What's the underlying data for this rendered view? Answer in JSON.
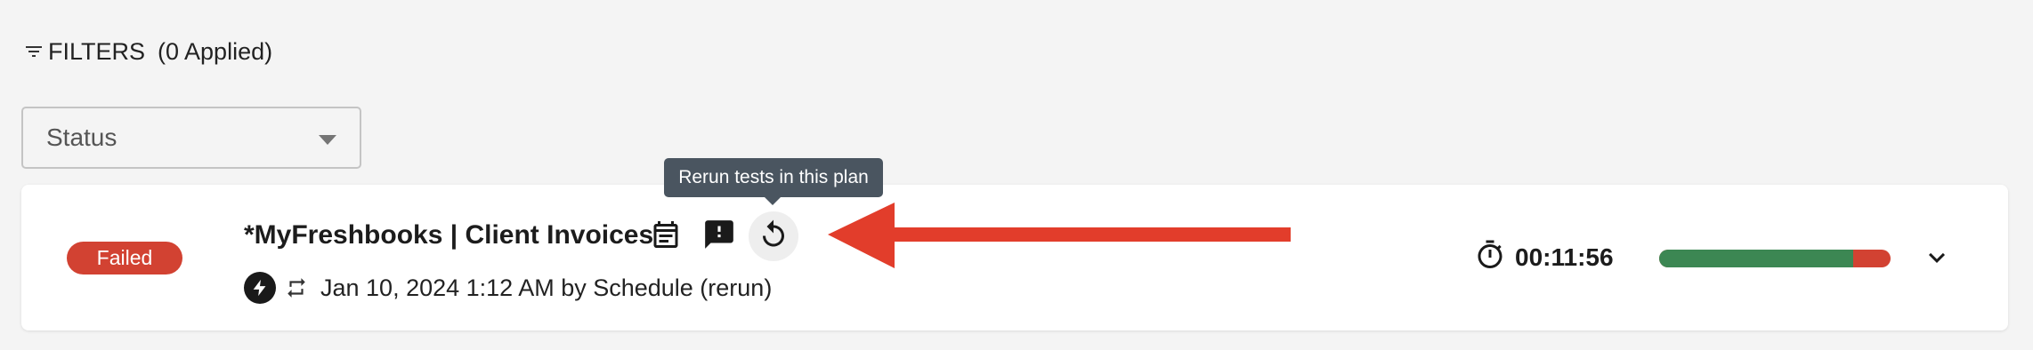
{
  "filters": {
    "label": "FILTERS",
    "applied_count": "(0 Applied)",
    "icon": "filter-list-icon"
  },
  "status_select": {
    "value": "Status",
    "icon": "arrow-drop-down-icon"
  },
  "run": {
    "status": "Failed",
    "status_color": "#d24232",
    "title": "*MyFreshbooks | Client Invoices",
    "actions": [
      {
        "icon": "calendar-icon"
      },
      {
        "icon": "feedback-icon"
      },
      {
        "icon": "rerun-icon"
      }
    ],
    "tooltip": "Rerun tests in this plan",
    "trigger_icon": "bolt-icon",
    "rerun_indicator_icon": "repeat-icon",
    "meta": "Jan 10, 2024 1:12 AM by Schedule (rerun)",
    "duration": "00:11:56",
    "duration_icon": "timer-icon",
    "progress": {
      "passed_fraction": 0.84,
      "pass_color": "#3c8753",
      "fail_color": "#d24232"
    },
    "expand_icon": "chevron-down-icon"
  },
  "annotation": {
    "arrow_color": "#e23d2b"
  }
}
